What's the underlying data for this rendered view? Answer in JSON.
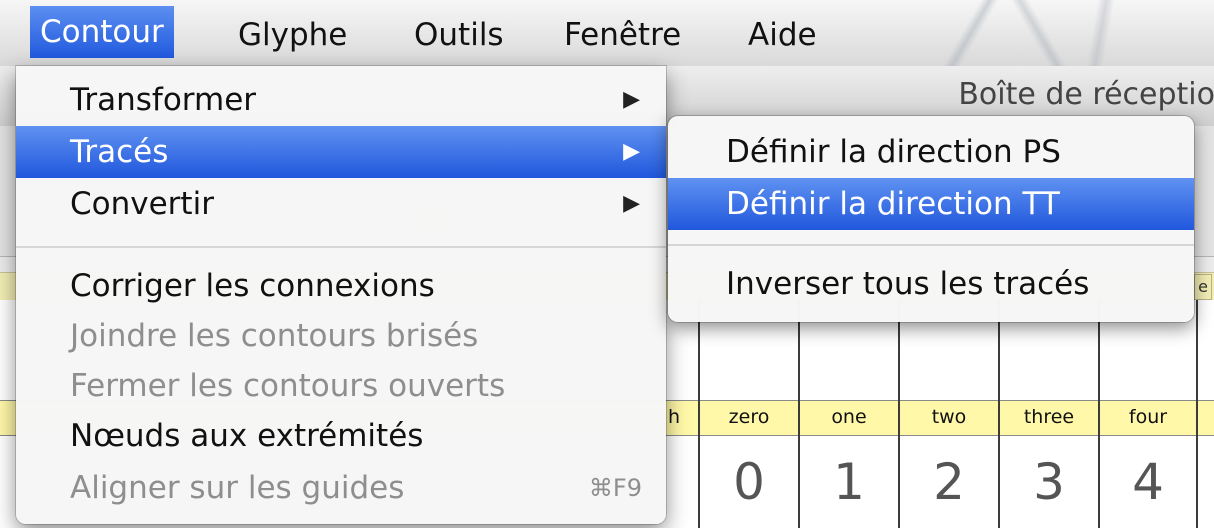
{
  "menubar": {
    "items": [
      {
        "label": "Contour",
        "active": true
      },
      {
        "label": "Glyphe"
      },
      {
        "label": "Outils"
      },
      {
        "label": "Fenêtre"
      },
      {
        "label": "Aide"
      }
    ]
  },
  "window": {
    "title": "Boîte de réception"
  },
  "menu": {
    "items": [
      {
        "label": "Transformer",
        "submenu": true,
        "enabled": true
      },
      {
        "label": "Tracés",
        "submenu": true,
        "enabled": true,
        "highlighted": true
      },
      {
        "label": "Convertir",
        "submenu": true,
        "enabled": true
      },
      {
        "label": "Corriger les connexions",
        "enabled": true
      },
      {
        "label": "Joindre les contours brisés",
        "enabled": false
      },
      {
        "label": "Fermer les contours ouverts",
        "enabled": false
      },
      {
        "label": "Nœuds aux extrémités",
        "enabled": true
      },
      {
        "label": "Aligner sur les guides",
        "enabled": false,
        "shortcut": "⌘F9"
      }
    ]
  },
  "submenu": {
    "items": [
      {
        "label": "Définir la direction PS"
      },
      {
        "label": "Définir la direction TT",
        "highlighted": true
      },
      {
        "label": "Inverser tous les tracés"
      }
    ]
  },
  "glyph_grid": {
    "partial_label": "h",
    "cells": [
      {
        "name": "zero",
        "glyph": "0"
      },
      {
        "name": "one",
        "glyph": "1"
      },
      {
        "name": "two",
        "glyph": "2"
      },
      {
        "name": "three",
        "glyph": "3"
      },
      {
        "name": "four",
        "glyph": "4"
      }
    ]
  },
  "colors": {
    "highlight": "#2f6be3",
    "name_row": "#fff8a8",
    "disabled_text": "#8e8e8e"
  }
}
